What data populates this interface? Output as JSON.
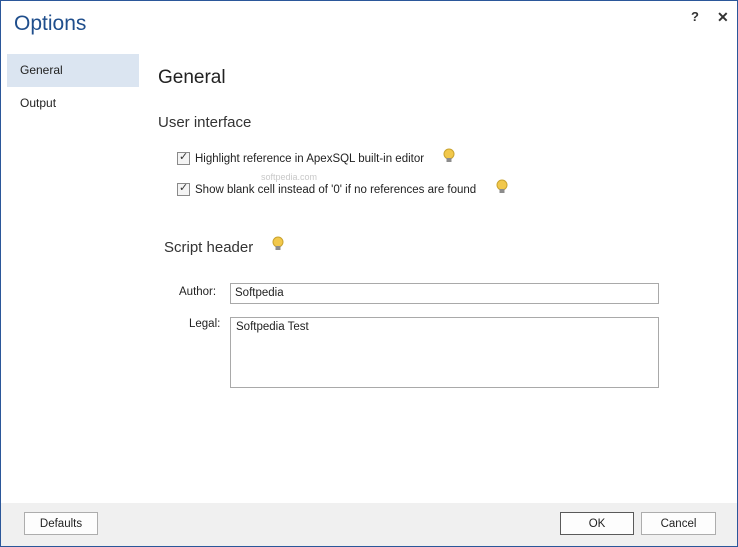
{
  "window": {
    "title": "Options",
    "help": "?",
    "close": "✕"
  },
  "nav": {
    "items": [
      {
        "label": "General"
      },
      {
        "label": "Output"
      }
    ]
  },
  "main": {
    "heading": "General",
    "user_interface": {
      "heading": "User interface",
      "highlight_label": "Highlight reference in ApexSQL built-in editor",
      "blank_label": "Show blank cell instead of '0' if no references are found"
    },
    "script_header": {
      "heading": "Script header",
      "author_label": "Author:",
      "author_value": "Softpedia",
      "legal_label": "Legal:",
      "legal_value": "Softpedia Test"
    },
    "watermark": "softpedia.com"
  },
  "footer": {
    "defaults": "Defaults",
    "ok": "OK",
    "cancel": "Cancel"
  },
  "colors": {
    "title": "#1f4e8c",
    "nav_active": "#dbe5f1",
    "footer": "#f0f0f0",
    "bulb": "#f2c84b"
  }
}
